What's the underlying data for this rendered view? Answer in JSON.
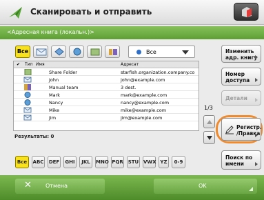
{
  "header": {
    "title": "Сканировать и отправить"
  },
  "subtitle": "<Адресная книга (локальн.)>",
  "filter": {
    "all_label": "Все",
    "dropdown_value": "Все"
  },
  "table": {
    "columns": [
      "Тип",
      "Имя",
      "Адресат"
    ],
    "rows": [
      {
        "icon": "share-folder-icon",
        "name": "Share Folder",
        "address": "starfish.organization.company.co"
      },
      {
        "icon": "email-icon",
        "name": "John",
        "address": "john@example.com"
      },
      {
        "icon": "group-icon",
        "name": "Manual team",
        "address": "3 dest."
      },
      {
        "icon": "fax-icon",
        "name": "Mark",
        "address": "mark@example.com"
      },
      {
        "icon": "fax-icon",
        "name": "Nancy",
        "address": "nancy@example.com"
      },
      {
        "icon": "email-icon",
        "name": "Mike",
        "address": "mike@example.com"
      },
      {
        "icon": "email-icon",
        "name": "Jim",
        "address": "jim@example.com"
      }
    ]
  },
  "results_label": "Результаты: 0",
  "pager": {
    "page": "1/3"
  },
  "alphabet": [
    "Все",
    "ABC",
    "DEF",
    "GHI",
    "JKL",
    "MNO",
    "PQR",
    "STU",
    "VWX",
    "YZ",
    "0-9"
  ],
  "right_buttons": {
    "change_book": "Изменить\nадр. книгу",
    "access_number": "Номер\nдоступа",
    "details": "Детали",
    "register": "Регистр.\n/Правка",
    "search_by_name": "Поиск по\nимени"
  },
  "footer": {
    "cancel": "Отмена",
    "ok": "OK"
  },
  "colors": {
    "accent_green": "#6aa643",
    "selected_yellow": "#f9e21a",
    "highlight_orange": "#f08a2b"
  }
}
